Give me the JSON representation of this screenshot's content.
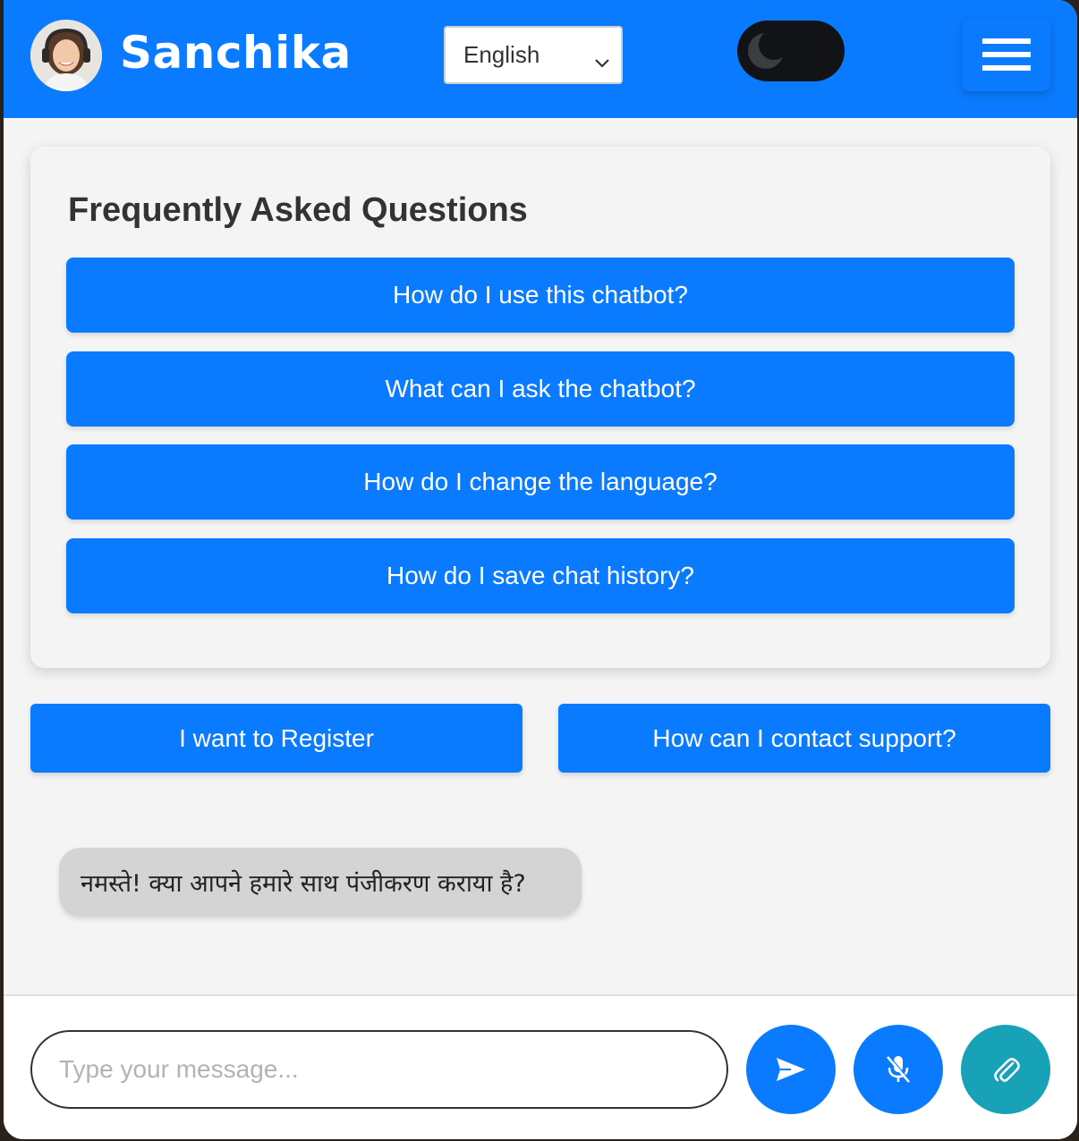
{
  "header": {
    "brand_name": "Sanchika",
    "language_selected": "English",
    "colors": {
      "primary": "#0a7bff",
      "toggle_bg": "#111316"
    },
    "icons": [
      "avatar",
      "moon-icon",
      "hamburger-icon",
      "chevron-down-icon"
    ]
  },
  "faq": {
    "title": "Frequently Asked Questions",
    "questions": [
      "How do I use this chatbot?",
      "What can I ask the chatbot?",
      "How do I change the language?",
      "How do I save chat history?"
    ]
  },
  "quick_actions": {
    "register": "I want to Register",
    "support": "How can I contact support?"
  },
  "chat": {
    "messages": [
      {
        "from": "bot",
        "text": "नमस्ते! क्या आपने हमारे साथ पंजीकरण कराया है?"
      }
    ]
  },
  "composer": {
    "placeholder": "Type your message...",
    "icons": [
      "send-icon",
      "mic-off-icon",
      "paperclip-icon"
    ],
    "colors": {
      "send": "#0a7bff",
      "mic": "#0a7bff",
      "attach": "#17a2b8"
    }
  }
}
